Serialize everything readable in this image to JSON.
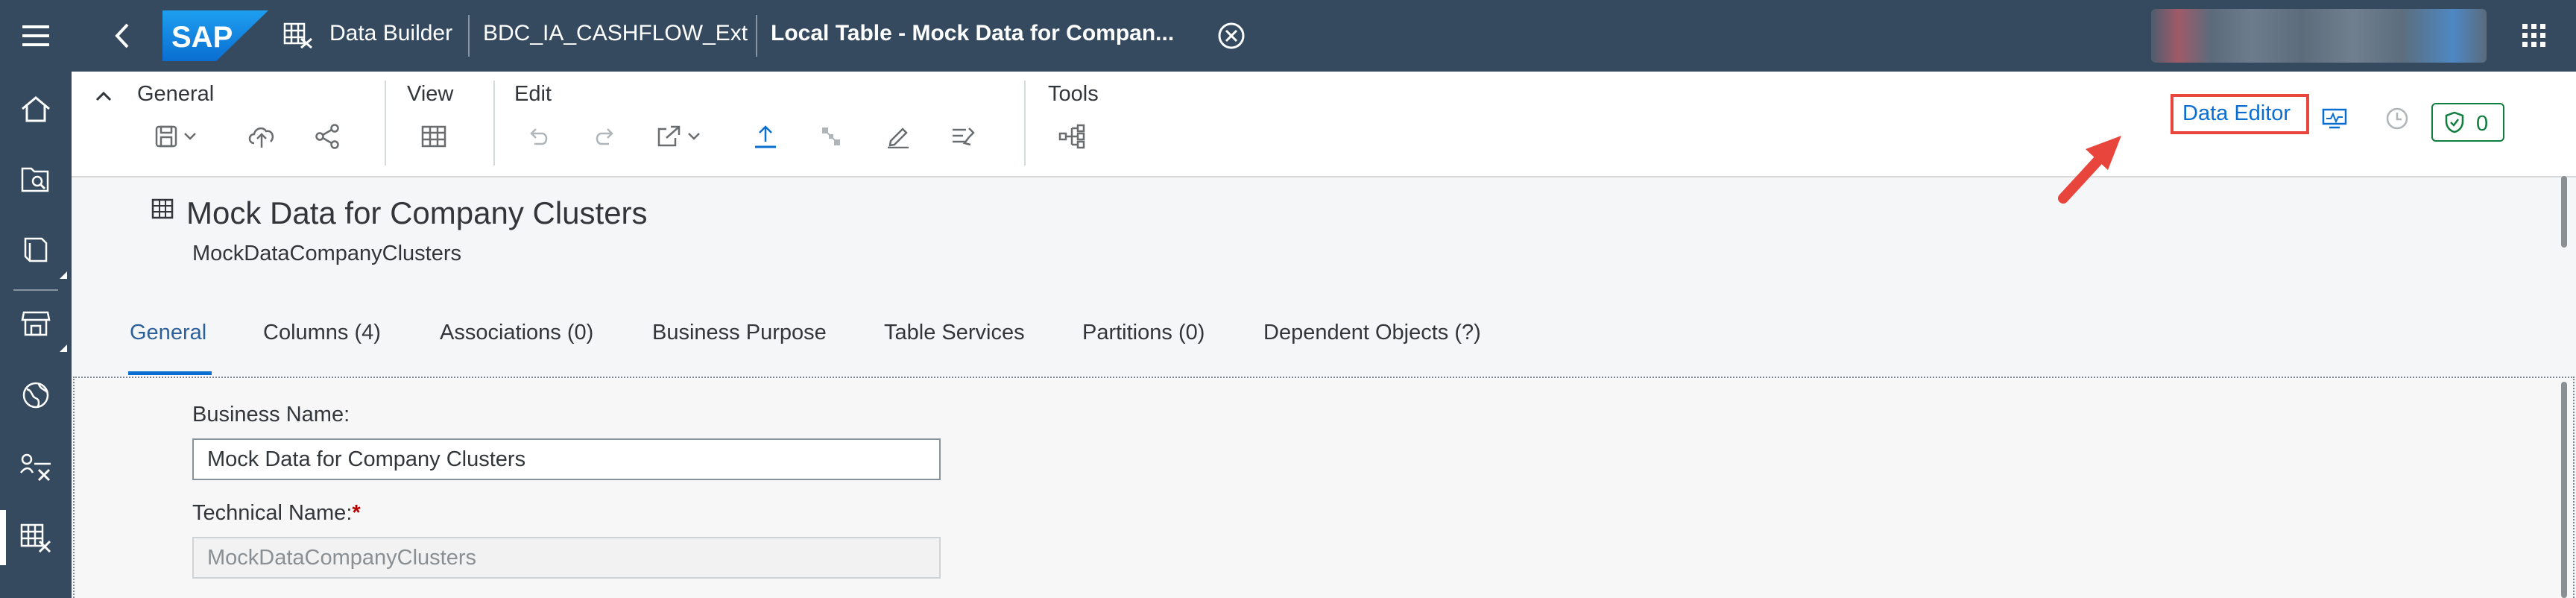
{
  "shell": {
    "app_name": "Data Builder",
    "space": "BDC_IA_CASHFLOW_Ext",
    "tab_title": "Local Table - Mock Data for Compan...",
    "logo_text": "SAP"
  },
  "sidebar": {
    "items": [
      {
        "icon": "home-icon"
      },
      {
        "icon": "catalog-search-icon"
      },
      {
        "icon": "repository-icon"
      },
      {
        "icon": "marketplace-icon"
      },
      {
        "icon": "globe-icon"
      },
      {
        "icon": "data-flow-icon"
      },
      {
        "icon": "data-builder-icon"
      }
    ]
  },
  "toolbar": {
    "groups": [
      {
        "label": "General"
      },
      {
        "label": "View"
      },
      {
        "label": "Edit"
      },
      {
        "label": "Tools"
      }
    ],
    "data_editor_label": "Data Editor",
    "validation_count": "0"
  },
  "object": {
    "title": "Mock Data for Company Clusters",
    "subtitle": "MockDataCompanyClusters"
  },
  "tabs": [
    {
      "label": "General",
      "active": true
    },
    {
      "label": "Columns (4)"
    },
    {
      "label": "Associations (0)"
    },
    {
      "label": "Business Purpose"
    },
    {
      "label": "Table Services"
    },
    {
      "label": "Partitions (0)"
    },
    {
      "label": "Dependent Objects (?)"
    }
  ],
  "form": {
    "business_name_label": "Business Name:",
    "business_name_value": "Mock Data for Company Clusters",
    "technical_name_label": "Technical Name:",
    "required_marker": "*",
    "technical_name_value": "MockDataCompanyClusters"
  },
  "colors": {
    "shell": "#354a5f",
    "accent": "#0a6ed1",
    "highlight": "#e8453c",
    "success": "#107e3e"
  }
}
